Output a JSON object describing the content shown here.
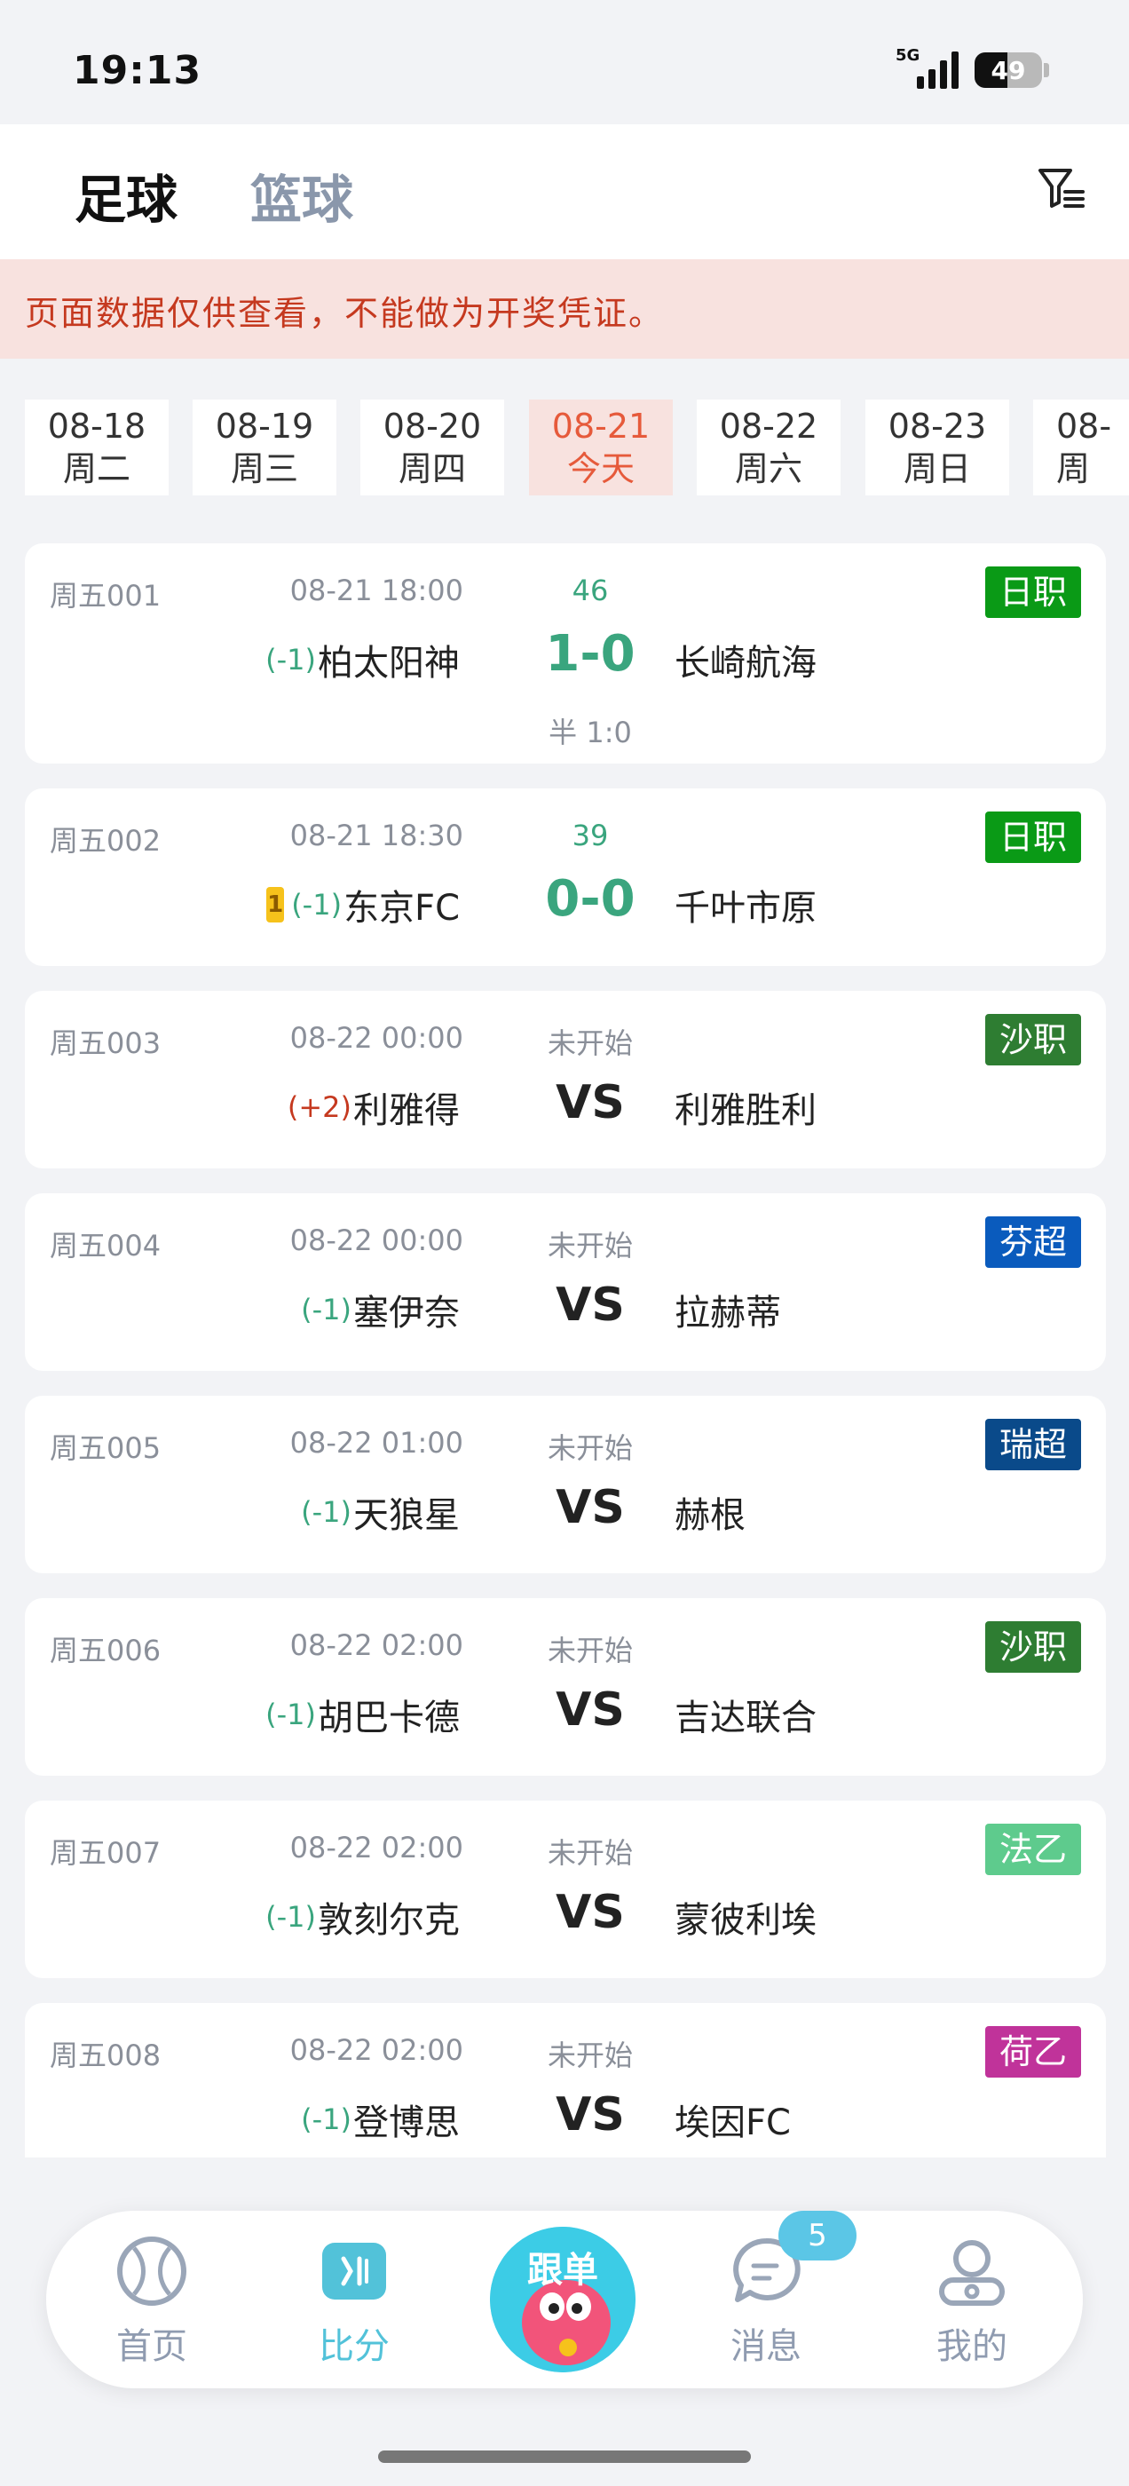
{
  "status_bar": {
    "time": "19:13",
    "network": "5G",
    "battery": "49",
    "battery_level": 0.49
  },
  "top_tabs": {
    "active": "足球",
    "inactive": "篮球"
  },
  "notice": "页面数据仅供查看，不能做为开奖凭证。",
  "dates": [
    {
      "date": "08-18",
      "day": "周二"
    },
    {
      "date": "08-19",
      "day": "周三"
    },
    {
      "date": "08-20",
      "day": "周四"
    },
    {
      "date": "08-21",
      "day": "今天",
      "active": true
    },
    {
      "date": "08-22",
      "day": "周六"
    },
    {
      "date": "08-23",
      "day": "周日"
    },
    {
      "date": "08-",
      "day": "周"
    }
  ],
  "matches": [
    {
      "code": "周五001",
      "time": "08-21 18:00",
      "status": "46",
      "live": true,
      "league": "日职",
      "league_color": "#0a9a16",
      "home_hc": "(-1)",
      "home": "柏太阳神",
      "score": "1-0",
      "away": "长崎航海",
      "half": "半 1:0"
    },
    {
      "code": "周五002",
      "time": "08-21 18:30",
      "status": "39",
      "live": true,
      "league": "日职",
      "league_color": "#0a9a16",
      "card": "1",
      "home_hc": "(-1)",
      "home": "东京FC",
      "score": "0-0",
      "away": "千叶市原"
    },
    {
      "code": "周五003",
      "time": "08-22 00:00",
      "status": "未开始",
      "league": "沙职",
      "league_color": "#2e7d32",
      "home_hc": "(+2)",
      "home": "利雅得",
      "score": "VS",
      "away": "利雅胜利"
    },
    {
      "code": "周五004",
      "time": "08-22 00:00",
      "status": "未开始",
      "league": "芬超",
      "league_color": "#0a5bbd",
      "home_hc": "(-1)",
      "home": "塞伊奈",
      "score": "VS",
      "away": "拉赫蒂"
    },
    {
      "code": "周五005",
      "time": "08-22 01:00",
      "status": "未开始",
      "league": "瑞超",
      "league_color": "#0a4a8a",
      "home_hc": "(-1)",
      "home": "天狼星",
      "score": "VS",
      "away": "赫根"
    },
    {
      "code": "周五006",
      "time": "08-22 02:00",
      "status": "未开始",
      "league": "沙职",
      "league_color": "#2e7d32",
      "home_hc": "(-1)",
      "home": "胡巴卡德",
      "score": "VS",
      "away": "吉达联合"
    },
    {
      "code": "周五007",
      "time": "08-22 02:00",
      "status": "未开始",
      "league": "法乙",
      "league_color": "#5ecb8d",
      "home_hc": "(-1)",
      "home": "敦刻尔克",
      "score": "VS",
      "away": "蒙彼利埃"
    },
    {
      "code": "周五008",
      "time": "08-22 02:00",
      "status": "未开始",
      "league": "荷乙",
      "league_color": "#c0339a",
      "home_hc": "(-1)",
      "home": "登博思",
      "score": "VS",
      "away": "埃因FC"
    }
  ],
  "bottom_nav": {
    "home": "首页",
    "score": "比分",
    "center": "跟单",
    "messages": "消息",
    "messages_badge": "5",
    "mine": "我的"
  }
}
